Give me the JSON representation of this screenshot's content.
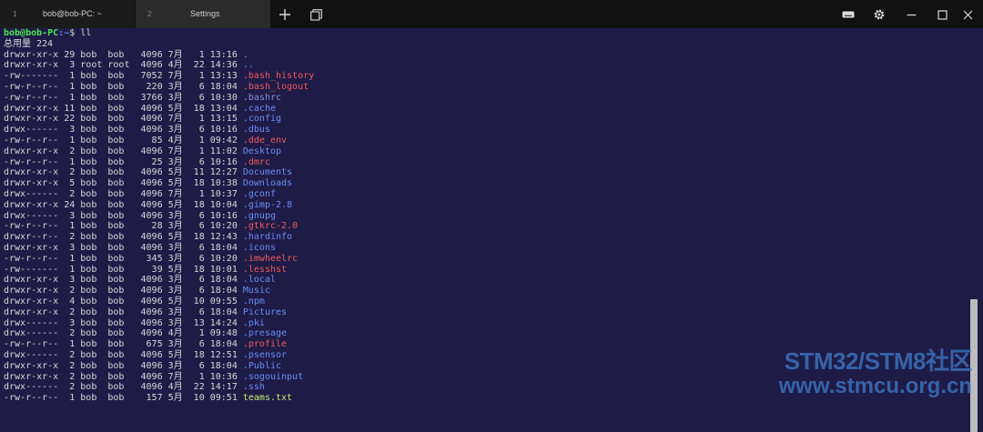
{
  "titlebar": {
    "tabs": [
      {
        "index": "1",
        "title": "bob@bob-PC: ~"
      },
      {
        "index": "2",
        "title": "Settings"
      }
    ],
    "icons": [
      "plus-icon",
      "windows-icon",
      "keyboard-icon",
      "gear-icon",
      "minimize-icon",
      "maximize-icon",
      "close-icon"
    ]
  },
  "terminal": {
    "prompt": {
      "user_host": "bob@bob-PC",
      "path": ":~",
      "sign": "$ ",
      "command": "ll"
    },
    "total": "总用量 224",
    "colors": {
      "dir": "#6b8ff5",
      "hidden_file": "#f05a5a",
      "plain_file": "#8a93d6",
      "txt_file": "#c6ec6e",
      "text": "#d8d8d8",
      "prompt_user": "#4ee84e"
    },
    "entries": [
      {
        "perm": "drwxr-xr-x",
        "links": "29",
        "owner": "bob",
        "group": "bob",
        "size": "4096",
        "month": "7月",
        "day": "1",
        "time": "13:16",
        "name": ".",
        "type": "dir"
      },
      {
        "perm": "drwxr-xr-x",
        "links": "3",
        "owner": "root",
        "group": "root",
        "size": "4096",
        "month": "4月",
        "day": "22",
        "time": "14:36",
        "name": "..",
        "type": "dir"
      },
      {
        "perm": "-rw-------",
        "links": "1",
        "owner": "bob",
        "group": "bob",
        "size": "7052",
        "month": "7月",
        "day": "1",
        "time": "13:13",
        "name": ".bash_history",
        "type": "hidden_file"
      },
      {
        "perm": "-rw-r--r--",
        "links": "1",
        "owner": "bob",
        "group": "bob",
        "size": "220",
        "month": "3月",
        "day": "6",
        "time": "18:04",
        "name": ".bash_logout",
        "type": "hidden_file"
      },
      {
        "perm": "-rw-r--r--",
        "links": "1",
        "owner": "bob",
        "group": "bob",
        "size": "3766",
        "month": "3月",
        "day": "6",
        "time": "10:30",
        "name": ".bashrc",
        "type": "plain_file"
      },
      {
        "perm": "drwxr-xr-x",
        "links": "11",
        "owner": "bob",
        "group": "bob",
        "size": "4096",
        "month": "5月",
        "day": "18",
        "time": "13:04",
        "name": ".cache",
        "type": "dir"
      },
      {
        "perm": "drwxr-xr-x",
        "links": "22",
        "owner": "bob",
        "group": "bob",
        "size": "4096",
        "month": "7月",
        "day": "1",
        "time": "13:15",
        "name": ".config",
        "type": "dir"
      },
      {
        "perm": "drwx------",
        "links": "3",
        "owner": "bob",
        "group": "bob",
        "size": "4096",
        "month": "3月",
        "day": "6",
        "time": "10:16",
        "name": ".dbus",
        "type": "dir"
      },
      {
        "perm": "-rw-r--r--",
        "links": "1",
        "owner": "bob",
        "group": "bob",
        "size": "85",
        "month": "4月",
        "day": "1",
        "time": "09:42",
        "name": ".dde_env",
        "type": "hidden_file"
      },
      {
        "perm": "drwxr-xr-x",
        "links": "2",
        "owner": "bob",
        "group": "bob",
        "size": "4096",
        "month": "7月",
        "day": "1",
        "time": "11:02",
        "name": "Desktop",
        "type": "dir"
      },
      {
        "perm": "-rw-r--r--",
        "links": "1",
        "owner": "bob",
        "group": "bob",
        "size": "25",
        "month": "3月",
        "day": "6",
        "time": "10:16",
        "name": ".dmrc",
        "type": "hidden_file"
      },
      {
        "perm": "drwxr-xr-x",
        "links": "2",
        "owner": "bob",
        "group": "bob",
        "size": "4096",
        "month": "5月",
        "day": "11",
        "time": "12:27",
        "name": "Documents",
        "type": "dir"
      },
      {
        "perm": "drwxr-xr-x",
        "links": "5",
        "owner": "bob",
        "group": "bob",
        "size": "4096",
        "month": "5月",
        "day": "18",
        "time": "10:38",
        "name": "Downloads",
        "type": "dir"
      },
      {
        "perm": "drwx------",
        "links": "2",
        "owner": "bob",
        "group": "bob",
        "size": "4096",
        "month": "7月",
        "day": "1",
        "time": "10:37",
        "name": ".gconf",
        "type": "dir"
      },
      {
        "perm": "drwxr-xr-x",
        "links": "24",
        "owner": "bob",
        "group": "bob",
        "size": "4096",
        "month": "5月",
        "day": "18",
        "time": "10:04",
        "name": ".gimp-2.8",
        "type": "dir"
      },
      {
        "perm": "drwx------",
        "links": "3",
        "owner": "bob",
        "group": "bob",
        "size": "4096",
        "month": "3月",
        "day": "6",
        "time": "10:16",
        "name": ".gnupg",
        "type": "dir"
      },
      {
        "perm": "-rw-r--r--",
        "links": "1",
        "owner": "bob",
        "group": "bob",
        "size": "28",
        "month": "3月",
        "day": "6",
        "time": "10:20",
        "name": ".gtkrc-2.0",
        "type": "hidden_file"
      },
      {
        "perm": "drwxr--r--",
        "links": "2",
        "owner": "bob",
        "group": "bob",
        "size": "4096",
        "month": "5月",
        "day": "18",
        "time": "12:43",
        "name": ".hardinfo",
        "type": "dir"
      },
      {
        "perm": "drwxr-xr-x",
        "links": "3",
        "owner": "bob",
        "group": "bob",
        "size": "4096",
        "month": "3月",
        "day": "6",
        "time": "18:04",
        "name": ".icons",
        "type": "dir"
      },
      {
        "perm": "-rw-r--r--",
        "links": "1",
        "owner": "bob",
        "group": "bob",
        "size": "345",
        "month": "3月",
        "day": "6",
        "time": "10:20",
        "name": ".imwheelrc",
        "type": "hidden_file"
      },
      {
        "perm": "-rw-------",
        "links": "1",
        "owner": "bob",
        "group": "bob",
        "size": "39",
        "month": "5月",
        "day": "18",
        "time": "10:01",
        "name": ".lesshst",
        "type": "hidden_file"
      },
      {
        "perm": "drwxr-xr-x",
        "links": "3",
        "owner": "bob",
        "group": "bob",
        "size": "4096",
        "month": "3月",
        "day": "6",
        "time": "18:04",
        "name": ".local",
        "type": "dir"
      },
      {
        "perm": "drwxr-xr-x",
        "links": "2",
        "owner": "bob",
        "group": "bob",
        "size": "4096",
        "month": "3月",
        "day": "6",
        "time": "18:04",
        "name": "Music",
        "type": "dir"
      },
      {
        "perm": "drwxr-xr-x",
        "links": "4",
        "owner": "bob",
        "group": "bob",
        "size": "4096",
        "month": "5月",
        "day": "10",
        "time": "09:55",
        "name": ".npm",
        "type": "dir"
      },
      {
        "perm": "drwxr-xr-x",
        "links": "2",
        "owner": "bob",
        "group": "bob",
        "size": "4096",
        "month": "3月",
        "day": "6",
        "time": "18:04",
        "name": "Pictures",
        "type": "dir"
      },
      {
        "perm": "drwx------",
        "links": "3",
        "owner": "bob",
        "group": "bob",
        "size": "4096",
        "month": "3月",
        "day": "13",
        "time": "14:24",
        "name": ".pki",
        "type": "dir"
      },
      {
        "perm": "drwx------",
        "links": "2",
        "owner": "bob",
        "group": "bob",
        "size": "4096",
        "month": "4月",
        "day": "1",
        "time": "09:48",
        "name": ".presage",
        "type": "dir"
      },
      {
        "perm": "-rw-r--r--",
        "links": "1",
        "owner": "bob",
        "group": "bob",
        "size": "675",
        "month": "3月",
        "day": "6",
        "time": "18:04",
        "name": ".profile",
        "type": "hidden_file"
      },
      {
        "perm": "drwx------",
        "links": "2",
        "owner": "bob",
        "group": "bob",
        "size": "4096",
        "month": "5月",
        "day": "18",
        "time": "12:51",
        "name": ".psensor",
        "type": "dir"
      },
      {
        "perm": "drwxr-xr-x",
        "links": "2",
        "owner": "bob",
        "group": "bob",
        "size": "4096",
        "month": "3月",
        "day": "6",
        "time": "18:04",
        "name": ".Public",
        "type": "dir"
      },
      {
        "perm": "drwxr-xr-x",
        "links": "2",
        "owner": "bob",
        "group": "bob",
        "size": "4096",
        "month": "7月",
        "day": "1",
        "time": "10:36",
        "name": ".sogouinput",
        "type": "dir"
      },
      {
        "perm": "drwx------",
        "links": "2",
        "owner": "bob",
        "group": "bob",
        "size": "4096",
        "month": "4月",
        "day": "22",
        "time": "14:17",
        "name": ".ssh",
        "type": "dir"
      },
      {
        "perm": "-rw-r--r--",
        "links": "1",
        "owner": "bob",
        "group": "bob",
        "size": "157",
        "month": "5月",
        "day": "10",
        "time": "09:51",
        "name": "teams.txt",
        "type": "txt_file"
      }
    ]
  },
  "watermark": {
    "line1": "STM32/STM8社区",
    "line2": "www.stmcu.org.cn"
  }
}
